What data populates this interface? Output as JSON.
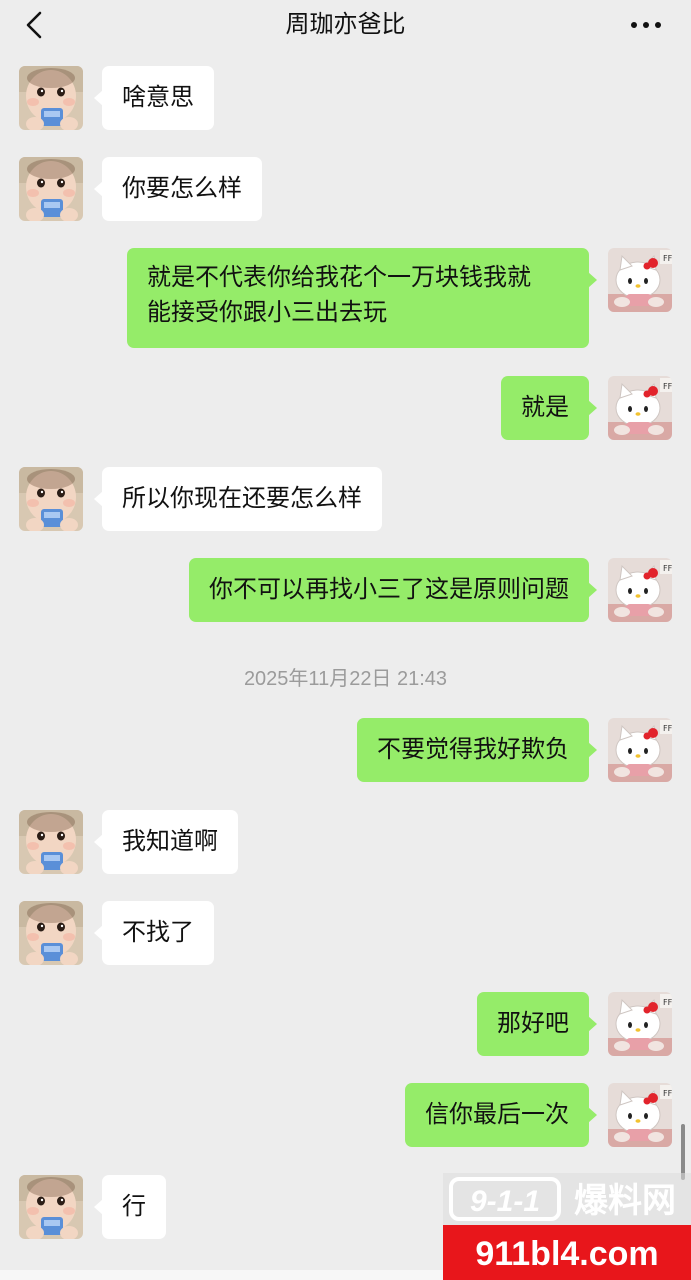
{
  "header": {
    "title": "周珈亦爸比",
    "back_icon": "chevron-left-icon",
    "more_icon": "ellipsis-icon"
  },
  "messages": [
    {
      "side": "left",
      "text": "啥意思"
    },
    {
      "side": "left",
      "text": "你要怎么样"
    },
    {
      "side": "right",
      "lines": [
        "就是不代表你给我花个一万块钱我就",
        "能接受你跟小三出去玩"
      ]
    },
    {
      "side": "right",
      "text": "就是"
    },
    {
      "side": "left",
      "text": "所以你现在还要怎么样"
    },
    {
      "side": "right",
      "text": "你不可以再找小三了这是原则问题"
    },
    {
      "side": "right",
      "text": "不要觉得我好欺负"
    },
    {
      "side": "left",
      "text": "我知道啊"
    },
    {
      "side": "left",
      "text": "不找了"
    },
    {
      "side": "right",
      "text": "那好吧"
    },
    {
      "side": "right",
      "text": "信你最后一次"
    },
    {
      "side": "left",
      "text": "行"
    }
  ],
  "timestamp": "2025年11月22日 21:43",
  "watermark": {
    "brand": "9-1-1",
    "name": "爆料网",
    "url": "911bl4.com"
  },
  "colors": {
    "background": "#ededed",
    "sent_bubble": "#95ec69",
    "received_bubble": "#ffffff",
    "watermark_red": "#e8161b"
  },
  "avatars": {
    "contact": "baby-photo-avatar",
    "self": "hello-kitty-avatar"
  }
}
